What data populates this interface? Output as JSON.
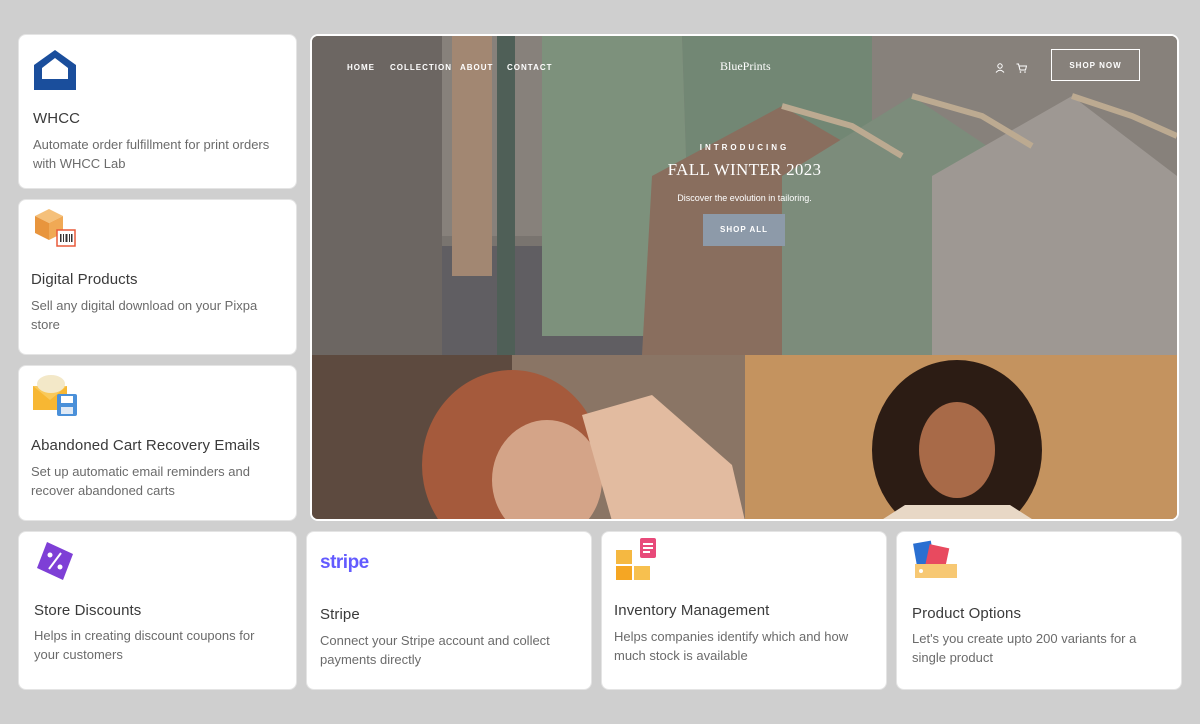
{
  "cards": {
    "whcc": {
      "title": "WHCC",
      "desc1": "Automate order fulfillment for print orders",
      "desc2": "with WHCC Lab",
      "icon": "house-logo-icon"
    },
    "digital": {
      "title": "Digital Products",
      "desc1": "Sell any digital download on your Pixpa",
      "desc2": "store",
      "icon": "box-barcode-icon"
    },
    "abandoned": {
      "title": "Abandoned Cart Recovery Emails",
      "desc1": "Set up automatic email reminders and",
      "desc2": "recover abandoned carts",
      "icon": "envelope-save-icon"
    },
    "discounts": {
      "title": "Store Discounts",
      "desc1": "Helps in creating discount coupons for",
      "desc2": "your customers",
      "icon": "discount-tag-icon"
    },
    "stripe": {
      "title": "Stripe",
      "logo": "stripe",
      "desc1": "Connect your Stripe account and collect",
      "desc2": "payments directly"
    },
    "inventory": {
      "title": "Inventory Management",
      "desc1": "Helps companies identify which and how",
      "desc2": "much stock is available",
      "icon": "boxes-clipboard-icon"
    },
    "options": {
      "title": "Product Options",
      "desc1": "Let's you create upto 200 variants for a",
      "desc2": "single product",
      "icon": "tags-icon"
    }
  },
  "hero": {
    "nav": [
      "HOME",
      "COLLECTION",
      "ABOUT",
      "CONTACT"
    ],
    "brand": "BluePrints",
    "shop_now": "SHOP NOW",
    "introducing": "INTRODUCING",
    "headline": "FALL WINTER 2023",
    "tagline": "Discover the evolution in tailoring.",
    "shop_all": "SHOP ALL"
  },
  "colors": {
    "background": "#cfcfcf",
    "accent_blue": "#1a4e9c",
    "stripe_purple": "#635bff",
    "shop_all": "#8d9aa9"
  }
}
